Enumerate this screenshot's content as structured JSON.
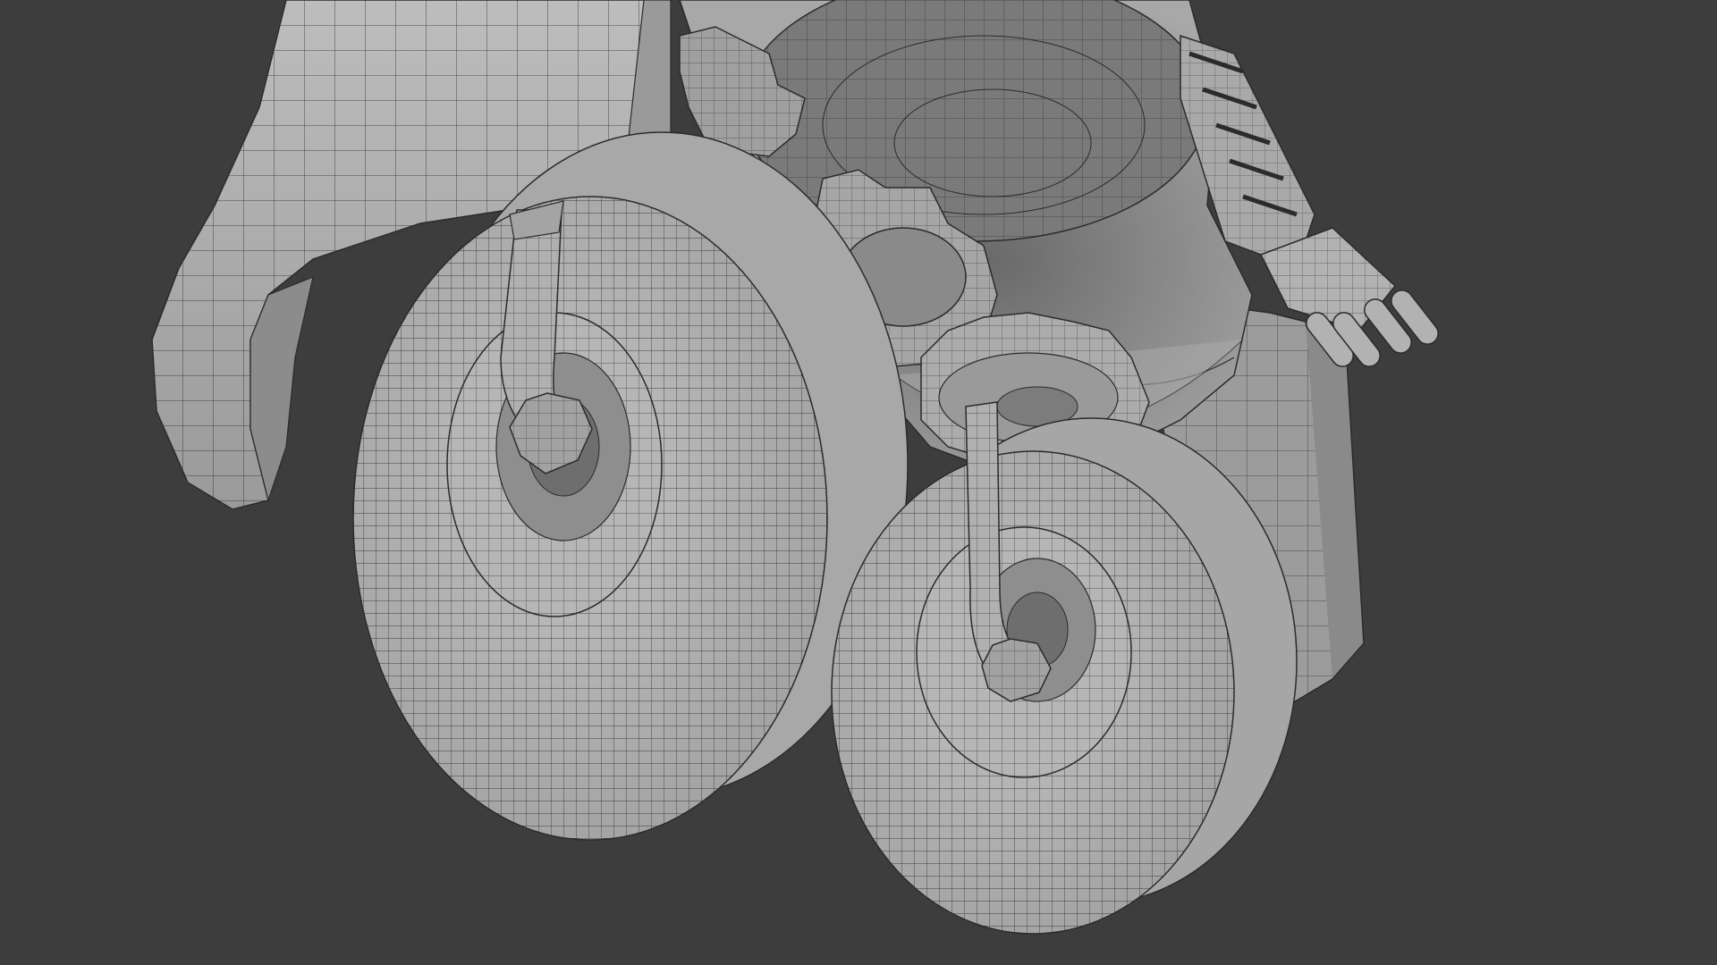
{
  "viewport": {
    "background": "#3d3d3d",
    "shading": "solid-wireframe",
    "mesh_fill": "#b4b4b4",
    "mesh_shadow": "#7a7a7a",
    "wire_color": "#2b2b2b",
    "icons": [
      "viewport-canvas"
    ]
  },
  "model": {
    "parts": [
      "fender",
      "fender-strut",
      "funnel-body",
      "back-plate",
      "upper-gear",
      "middle-gear",
      "lower-gear",
      "segmented-arm",
      "hand",
      "left-wheel",
      "left-axle-rod",
      "left-hex-nut",
      "right-wheel",
      "right-axle-rod",
      "right-hex-nut"
    ]
  }
}
